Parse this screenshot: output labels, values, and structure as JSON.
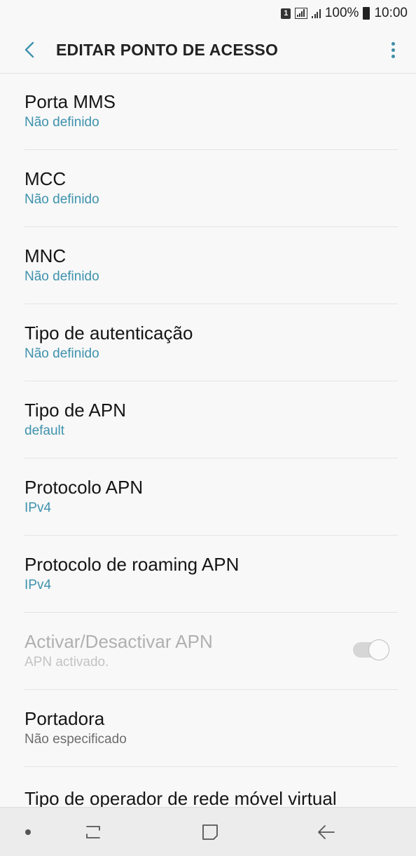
{
  "status_bar": {
    "sim_slot": "1",
    "battery": "100%",
    "time": "10:00"
  },
  "header": {
    "title": "EDITAR PONTO DE ACESSO",
    "back_icon": "chevron-left-icon",
    "more_icon": "more-vertical-icon"
  },
  "items": [
    {
      "label": "Porta MMS",
      "value": "Não definido"
    },
    {
      "label": "MCC",
      "value": "Não definido"
    },
    {
      "label": "MNC",
      "value": "Não definido"
    },
    {
      "label": "Tipo de autenticação",
      "value": "Não definido"
    },
    {
      "label": "Tipo de APN",
      "value": "default"
    },
    {
      "label": "Protocolo APN",
      "value": "IPv4"
    },
    {
      "label": "Protocolo de roaming APN",
      "value": "IPv4"
    },
    {
      "label": "Activar/Desactivar APN",
      "value": "APN activado.",
      "toggle_on": true,
      "disabled": true
    },
    {
      "label": "Portadora",
      "value": "Não especificado"
    }
  ],
  "partial_item": {
    "label": "Tipo de operador de rede móvel virtual"
  },
  "colors": {
    "accent": "#3e92ad",
    "background": "#f8f8f8",
    "nav_background": "#ececec"
  },
  "nav_bar": {
    "icons": [
      "indicator-dot-icon",
      "recent-apps-icon",
      "home-icon",
      "back-icon"
    ]
  }
}
